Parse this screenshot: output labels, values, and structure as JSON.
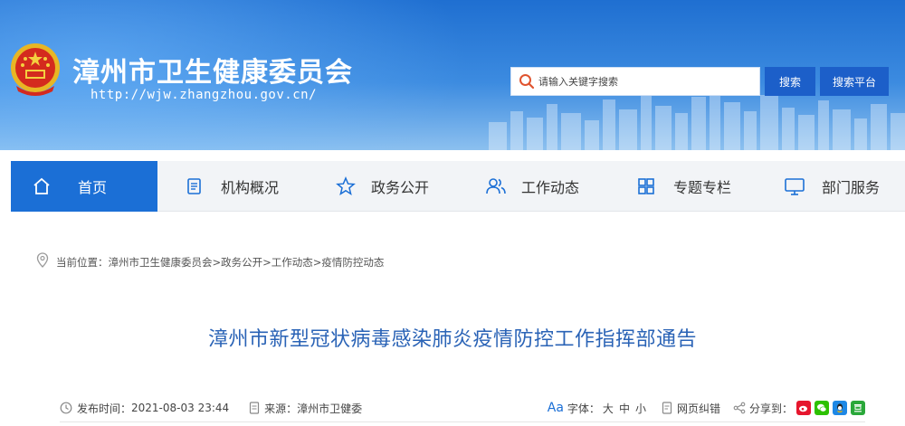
{
  "header": {
    "site_name": "漳州市卫生健康委员会",
    "site_url": "http://wjw.zhangzhou.gov.cn/",
    "search": {
      "placeholder": "请输入关键字搜索",
      "button_label": "搜索",
      "platform_label": "搜索平台"
    },
    "colors": {
      "banner": "#1f6fd1",
      "button": "#1c5fc9"
    }
  },
  "nav": {
    "items": [
      {
        "label": "首页",
        "icon": "home-icon",
        "active": true
      },
      {
        "label": "机构概况",
        "icon": "document-icon",
        "active": false
      },
      {
        "label": "政务公开",
        "icon": "star-icon",
        "active": false
      },
      {
        "label": "工作动态",
        "icon": "people-icon",
        "active": false
      },
      {
        "label": "专题专栏",
        "icon": "grid-icon",
        "active": false
      },
      {
        "label": "部门服务",
        "icon": "monitor-icon",
        "active": false
      }
    ],
    "active_color": "#1b6fd6"
  },
  "breadcrumb": {
    "prefix": "当前位置：",
    "items": [
      "漳州市卫生健康委员会",
      "政务公开",
      "工作动态",
      "疫情防控动态"
    ],
    "separator": ">"
  },
  "article": {
    "title": "漳州市新型冠状病毒感染肺炎疫情防控工作指挥部通告",
    "title_color": "#2a63b6",
    "meta": {
      "publish_label": "发布时间：",
      "publish_time": "2021-08-03 23:44",
      "source_label": "来源：",
      "source": "漳州市卫健委",
      "font_aa": "Aa",
      "font_label": "字体：",
      "font_sizes": [
        "大",
        "中",
        "小"
      ],
      "correction_label": "网页纠错",
      "share_label": "分享到："
    }
  }
}
